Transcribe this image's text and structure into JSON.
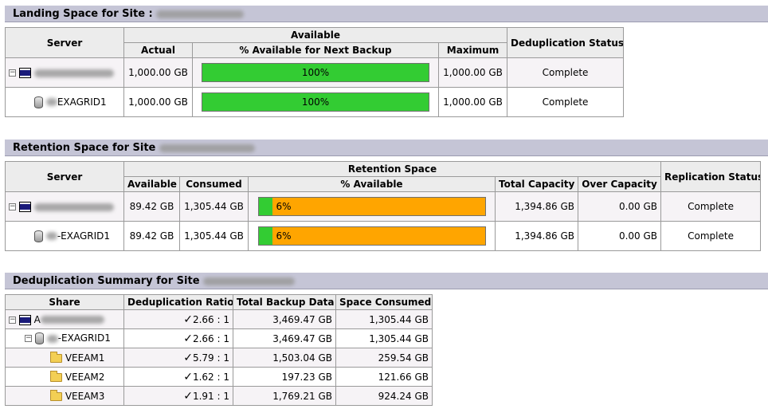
{
  "landing": {
    "header": "Landing Space for Site :",
    "headers": {
      "server": "Server",
      "available": "Available",
      "actual": "Actual",
      "pct_next": "% Available for Next Backup",
      "maximum": "Maximum",
      "dedup_status": "Deduplication Status"
    },
    "rows": [
      {
        "name": "",
        "actual": "1,000.00 GB",
        "pct": 100,
        "pct_label": "100%",
        "maximum": "1,000.00 GB",
        "status": "Complete"
      },
      {
        "name": "EXAGRID1",
        "actual": "1,000.00 GB",
        "pct": 100,
        "pct_label": "100%",
        "maximum": "1,000.00 GB",
        "status": "Complete"
      }
    ]
  },
  "retention": {
    "header": "Retention Space for Site",
    "headers": {
      "server": "Server",
      "retention_space": "Retention Space",
      "available": "Available",
      "consumed": "Consumed",
      "pct_available": "% Available",
      "total_capacity": "Total Capacity",
      "over_capacity": "Over Capacity",
      "replication_status": "Replication Status"
    },
    "rows": [
      {
        "name": "",
        "available": "89.42 GB",
        "consumed": "1,305.44 GB",
        "pct": 6,
        "pct_label": "6%",
        "total": "1,394.86 GB",
        "over": "0.00 GB",
        "status": "Complete"
      },
      {
        "name": "-EXAGRID1",
        "available": "89.42 GB",
        "consumed": "1,305.44 GB",
        "pct": 6,
        "pct_label": "6%",
        "total": "1,394.86 GB",
        "over": "0.00 GB",
        "status": "Complete"
      }
    ]
  },
  "dedup": {
    "header": "Deduplication Summary for Site",
    "headers": {
      "share": "Share",
      "ratio": "Deduplication Ratio",
      "total_backup": "Total Backup Data",
      "space_consumed": "Space Consumed"
    },
    "rows": [
      {
        "name": "A",
        "check": "✓",
        "ratio": "2.66 : 1",
        "total": "3,469.47 GB",
        "consumed": "1,305.44 GB"
      },
      {
        "name": "-EXAGRID1",
        "check": "✓",
        "ratio": "2.66 : 1",
        "total": "3,469.47 GB",
        "consumed": "1,305.44 GB"
      },
      {
        "name": "VEEAM1",
        "check": "✓",
        "ratio": "5.79 : 1",
        "total": "1,503.04 GB",
        "consumed": "259.54 GB"
      },
      {
        "name": "VEEAM2",
        "check": "✓",
        "ratio": "1.62 : 1",
        "total": "197.23 GB",
        "consumed": "121.66 GB"
      },
      {
        "name": "VEEAM3",
        "check": "✓",
        "ratio": "1.91 : 1",
        "total": "1,769.21 GB",
        "consumed": "924.24 GB"
      }
    ]
  },
  "icons": {
    "expander": "minus-box-icon",
    "server": "server-icon",
    "database": "database-icon",
    "folder": "folder-icon",
    "check": "checkmark-icon"
  },
  "colors": {
    "header_bg": "#c5c5d6",
    "bar_available": "#33cc33",
    "bar_used": "#ffa500"
  }
}
